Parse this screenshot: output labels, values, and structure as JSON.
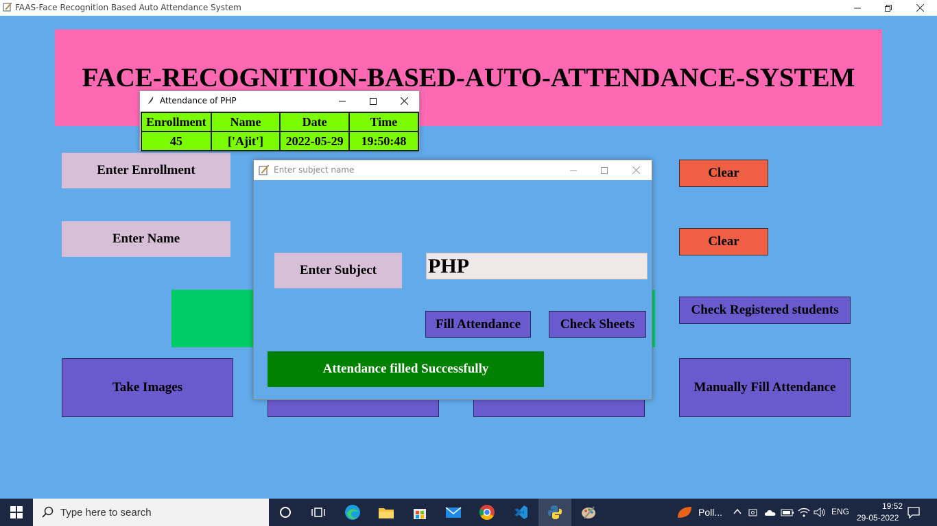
{
  "main_window": {
    "title": "FAAS-Face Recognition Based Auto Attendance System"
  },
  "banner": {
    "heading": "FACE-RECOGNITION-BASED-AUTO-ATTENDANCE-SYSTEM"
  },
  "form": {
    "enrollment_label": "Enter Enrollment",
    "name_label": "Enter Name",
    "clear_enrollment": "Clear",
    "clear_name": "Clear",
    "check_registered": "Check Registered students",
    "take_images": "Take Images",
    "manually_fill": "Manually Fill Attendance"
  },
  "attendance_window": {
    "title": "Attendance of PHP",
    "columns": [
      "Enrollment",
      "Name",
      "Date",
      "Time"
    ],
    "rows": [
      [
        "45",
        "['Ajit']",
        "2022-05-29",
        "19:50:48"
      ]
    ]
  },
  "subject_window": {
    "title": "Enter subject name",
    "subject_label": "Enter Subject",
    "subject_value": "PHP",
    "fill_attendance": "Fill Attendance",
    "check_sheets": "Check Sheets",
    "success_message": "Attendance filled Successfully"
  },
  "taskbar": {
    "search_placeholder": "Type here to search",
    "weather_label": "Poll...",
    "language": "ENG",
    "time": "19:52",
    "date": "29-05-2022"
  },
  "colors": {
    "background": "#62aaea",
    "banner": "#ff69b4",
    "label": "#d8bfd8",
    "clear_button": "#ee5f43",
    "action_button": "#6a5acd",
    "success": "#008000",
    "table_cell": "#7cfc00"
  }
}
